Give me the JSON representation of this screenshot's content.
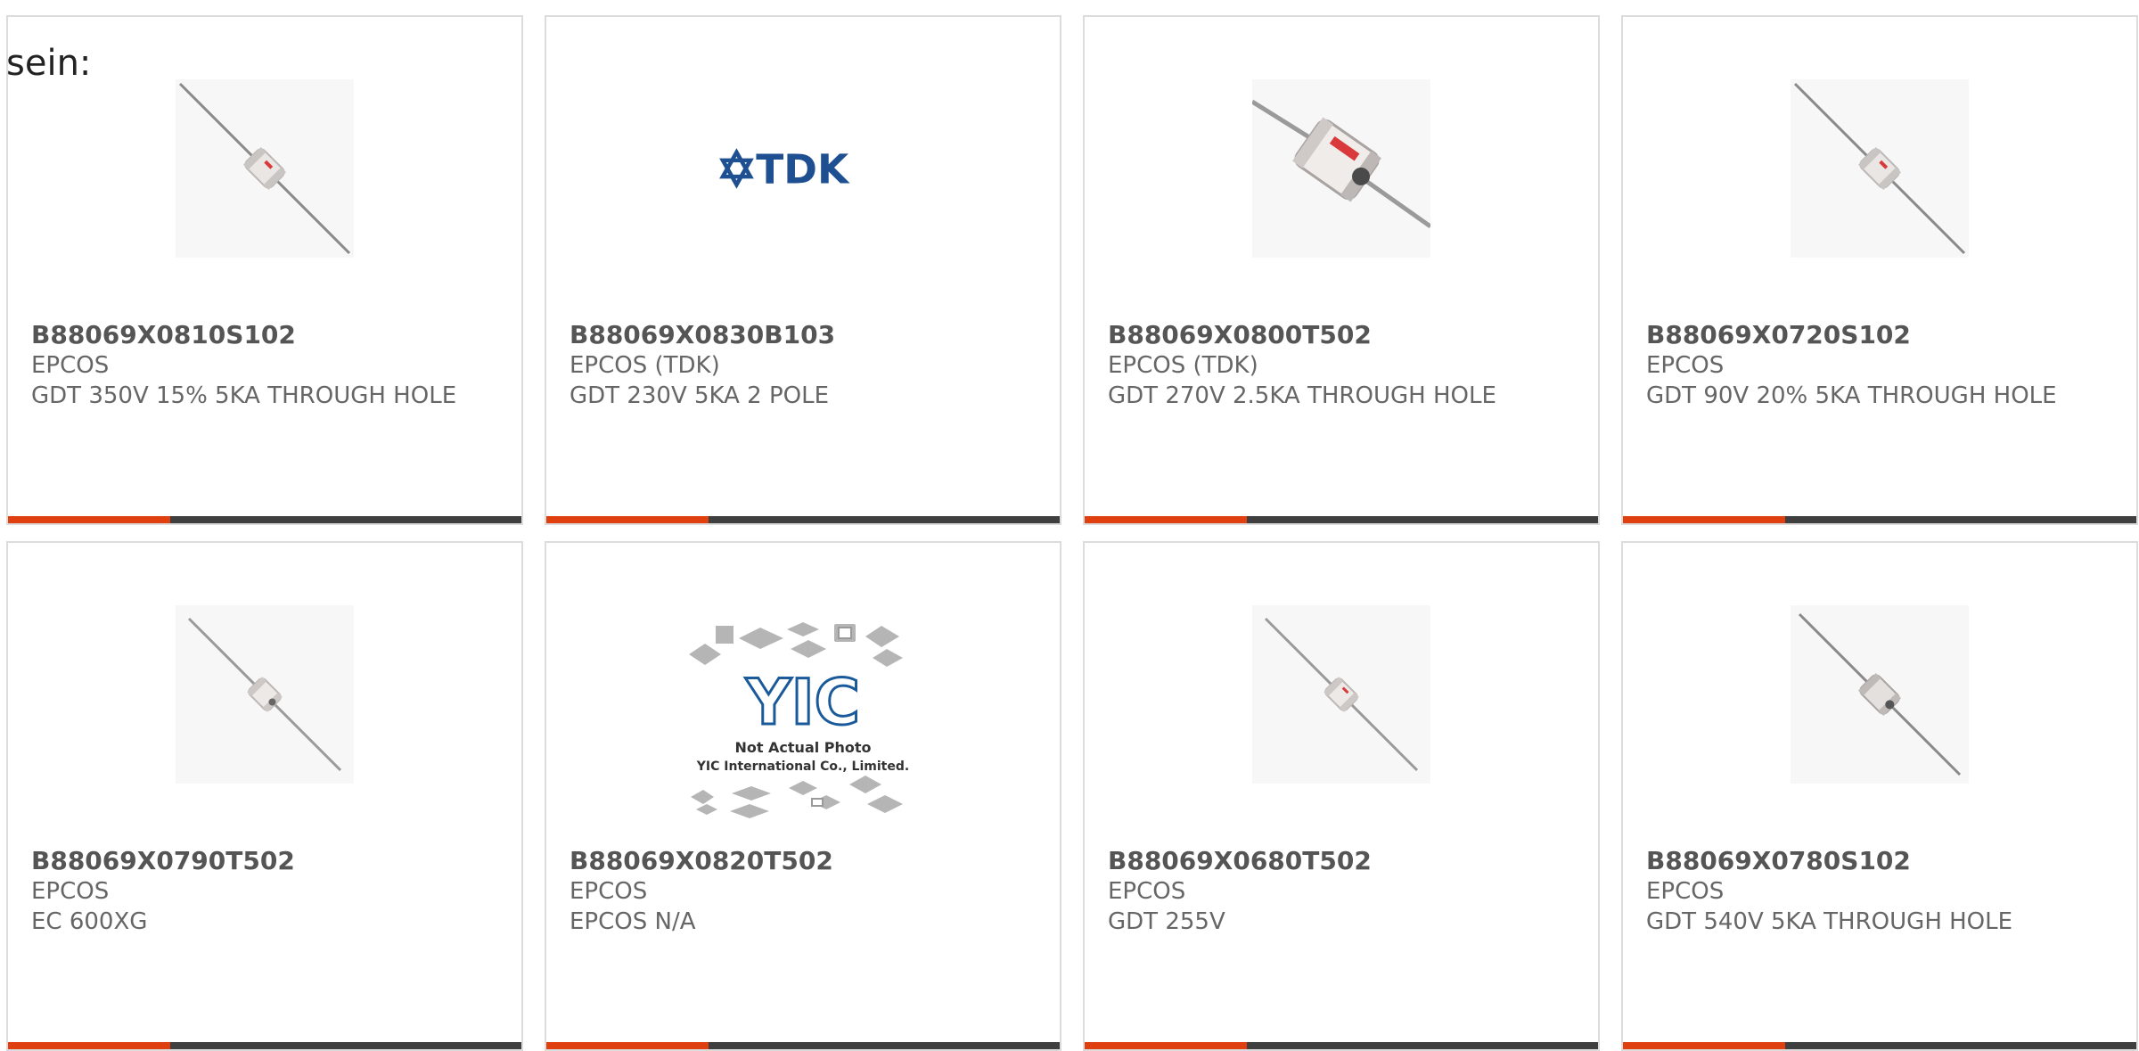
{
  "intro_text": "sein:",
  "colors": {
    "accent": "#e0400f",
    "bar": "#3f3f3f",
    "tdk_blue": "#1d4f91",
    "yic_blue": "#1b5a9a",
    "gdt_red": "#d9393a"
  },
  "products": [
    {
      "part": "B88069X0810S102",
      "manufacturer": "EPCOS",
      "description": "GDT 350V 15% 5KA THROUGH HOLE",
      "image": "gdt-axial-small-icon"
    },
    {
      "part": "B88069X0830B103",
      "manufacturer": "EPCOS (TDK)",
      "description": "GDT 230V 5KA 2 POLE",
      "image": "tdk-logo-icon"
    },
    {
      "part": "B88069X0800T502",
      "manufacturer": "EPCOS (TDK)",
      "description": "GDT 270V 2.5KA THROUGH HOLE",
      "image": "gdt-closeup-icon"
    },
    {
      "part": "B88069X0720S102",
      "manufacturer": "EPCOS",
      "description": "GDT 90V 20% 5KA THROUGH HOLE",
      "image": "gdt-axial-small-icon"
    },
    {
      "part": "B88069X0790T502",
      "manufacturer": "EPCOS",
      "description": "EC 600XG",
      "image": "gdt-axial-small-icon"
    },
    {
      "part": "B88069X0820T502",
      "manufacturer": "EPCOS",
      "description": "EPCOS N/A",
      "image": "yic-placeholder-icon"
    },
    {
      "part": "B88069X0680T502",
      "manufacturer": "EPCOS",
      "description": "GDT 255V",
      "image": "gdt-axial-small-icon"
    },
    {
      "part": "B88069X0780S102",
      "manufacturer": "EPCOS",
      "description": "GDT 540V 5KA THROUGH HOLE",
      "image": "gdt-axial-small-icon"
    }
  ],
  "logos": {
    "tdk_text": "TDK",
    "yic_mark": "YIC",
    "yic_line1": "Not Actual Photo",
    "yic_line2": "YIC International Co., Limited."
  }
}
